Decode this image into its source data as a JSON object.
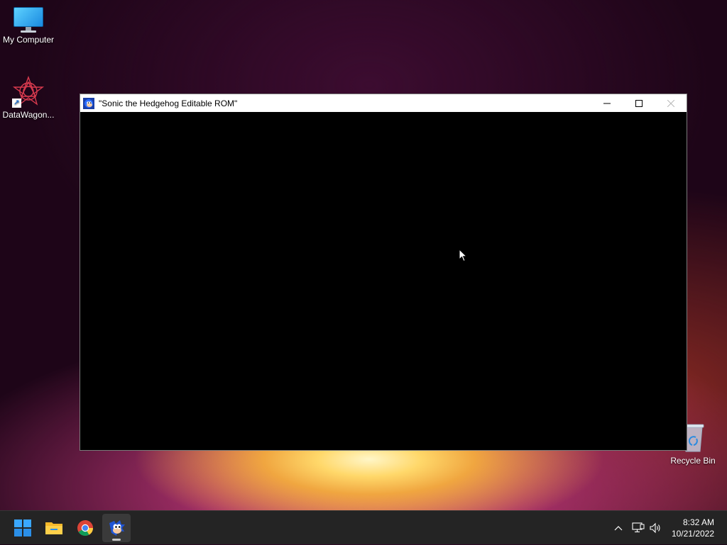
{
  "desktop": {
    "icons": [
      {
        "label": "My Computer",
        "icon": "computer-monitor-icon"
      },
      {
        "label": "DataWagon...",
        "icon": "datawagon-star-icon"
      }
    ],
    "recycle_bin": {
      "label": "Recycle Bin",
      "icon": "recycle-bin-icon"
    }
  },
  "window": {
    "title": "\"Sonic the Hedgehog Editable ROM\"",
    "app_icon": "sonic-icon",
    "controls": {
      "minimize": "minimize-icon",
      "maximize": "maximize-icon",
      "close": "close-icon"
    }
  },
  "taskbar": {
    "items": [
      {
        "name": "start",
        "icon": "windows-logo-icon"
      },
      {
        "name": "file-explorer",
        "icon": "folder-icon"
      },
      {
        "name": "chrome",
        "icon": "chrome-icon"
      },
      {
        "name": "sonic",
        "icon": "sonic-icon",
        "active": true
      }
    ],
    "tray": {
      "chevron": "chevron-up-icon",
      "network": "network-icon",
      "volume": "speaker-icon"
    },
    "clock": {
      "time": "8:32 AM",
      "date": "10/21/2022"
    }
  },
  "colors": {
    "taskbar_bg": "#242424",
    "window_bg": "#000000",
    "accent": "#0078d4"
  }
}
